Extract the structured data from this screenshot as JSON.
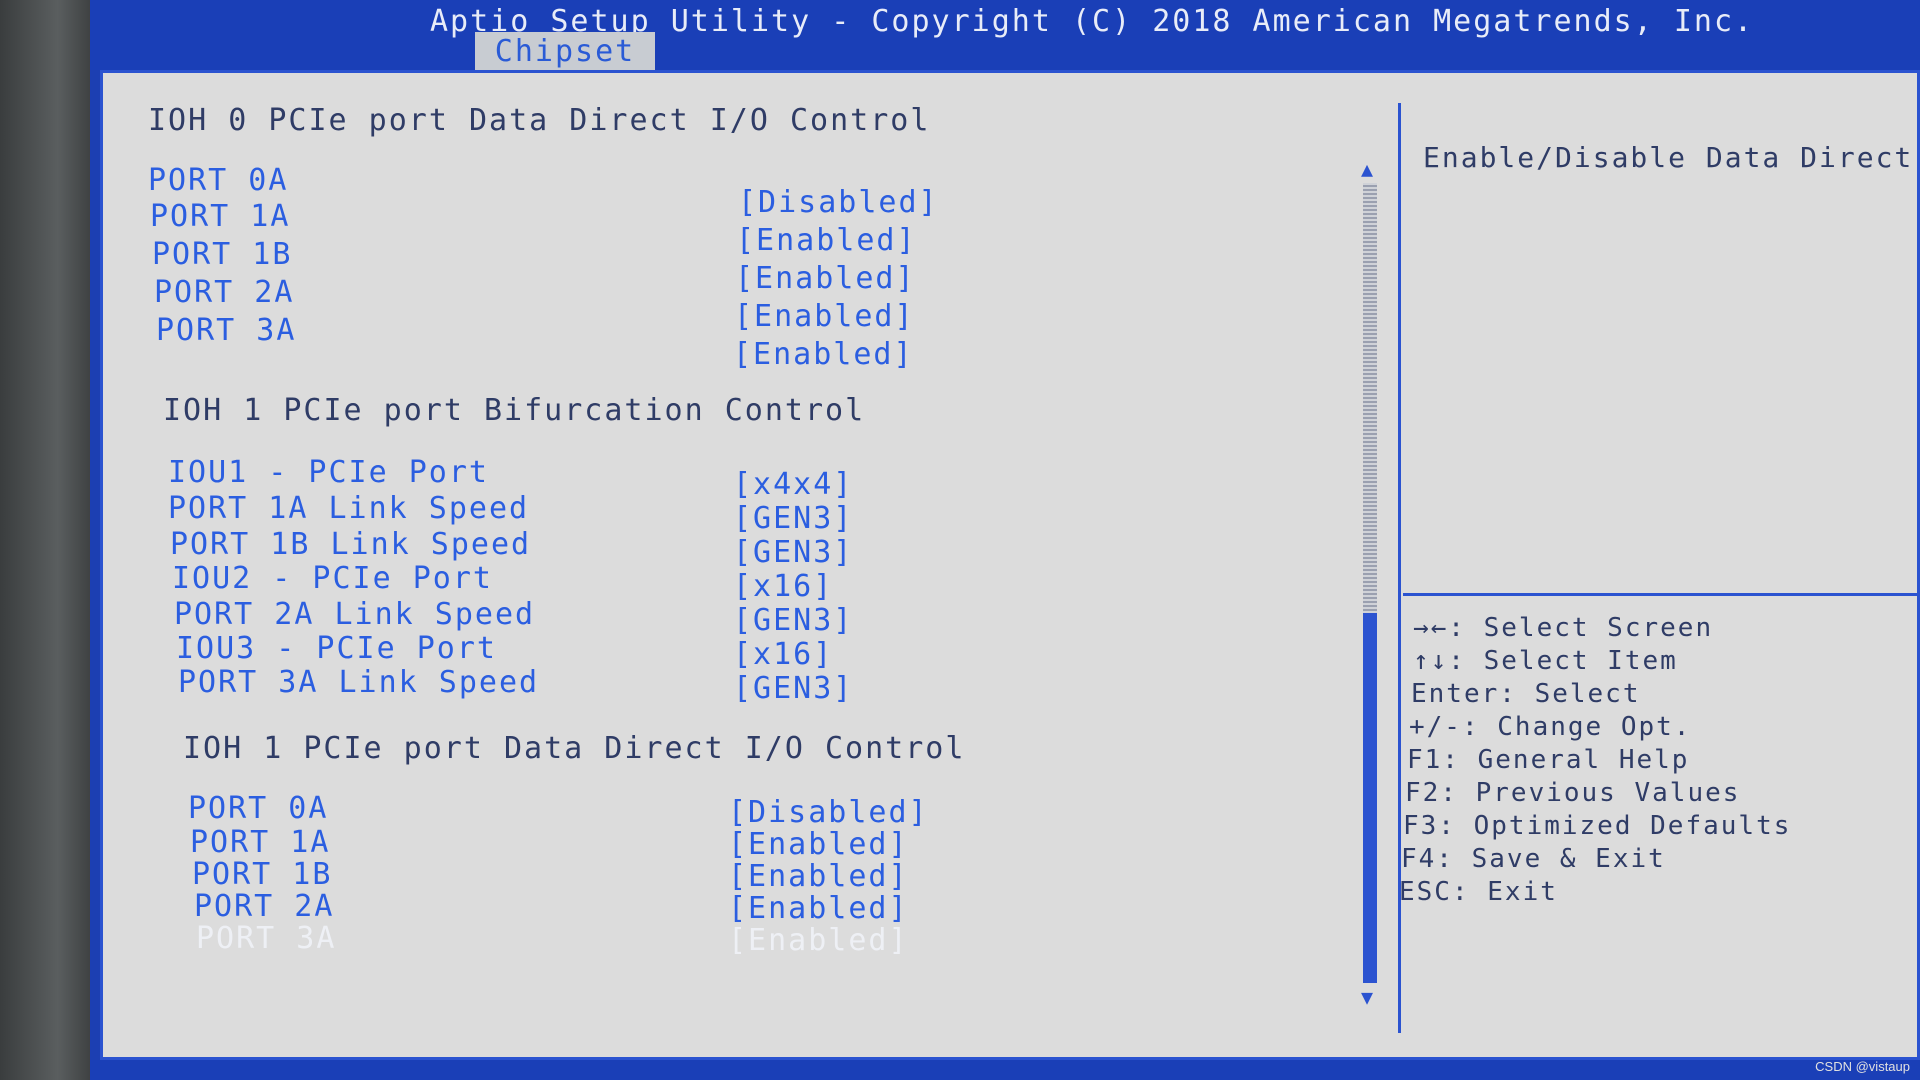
{
  "header": {
    "title": "Aptio Setup Utility - Copyright (C) 2018 American Megatrends, Inc.",
    "active_tab": "Chipset"
  },
  "sections": {
    "ioh0_ddio": {
      "heading": "IOH 0 PCIe port Data Direct I/O Control",
      "rows": [
        {
          "label": "PORT 0A",
          "value": "[Disabled]"
        },
        {
          "label": "PORT 1A",
          "value": "[Enabled]"
        },
        {
          "label": "PORT 1B",
          "value": "[Enabled]"
        },
        {
          "label": "PORT 2A",
          "value": "[Enabled]"
        },
        {
          "label": "PORT 3A",
          "value": "[Enabled]"
        }
      ]
    },
    "ioh1_bifurcation": {
      "heading": "IOH 1 PCIe port Bifurcation Control",
      "rows": [
        {
          "label": "IOU1 - PCIe Port",
          "value": "[x4x4]"
        },
        {
          "label": "PORT 1A Link Speed",
          "value": "[GEN3]"
        },
        {
          "label": "PORT 1B Link Speed",
          "value": "[GEN3]"
        },
        {
          "label": "IOU2 - PCIe Port",
          "value": "[x16]"
        },
        {
          "label": "PORT 2A Link Speed",
          "value": "[GEN3]"
        },
        {
          "label": "IOU3 - PCIe Port",
          "value": "[x16]"
        },
        {
          "label": "PORT 3A Link Speed",
          "value": "[GEN3]"
        }
      ]
    },
    "ioh1_ddio": {
      "heading": "IOH 1 PCIe port Data Direct I/O Control",
      "rows": [
        {
          "label": "PORT 0A",
          "value": "[Disabled]"
        },
        {
          "label": "PORT 1A",
          "value": "[Enabled]"
        },
        {
          "label": "PORT 1B",
          "value": "[Enabled]"
        },
        {
          "label": "PORT 2A",
          "value": "[Enabled]"
        },
        {
          "label": "PORT 3A",
          "value": "[Enabled]"
        }
      ]
    }
  },
  "help": {
    "description": "Enable/Disable Data Direct I/O",
    "keys": [
      "→←: Select Screen",
      "↑↓: Select Item",
      "Enter: Select",
      "+/-: Change Opt.",
      "F1: General Help",
      "F2: Previous Values",
      "F3: Optimized Defaults",
      "F4: Save & Exit",
      "ESC: Exit"
    ]
  },
  "watermark": "CSDN @vistaup",
  "colors": {
    "bios_blue": "#1a3fb7",
    "panel_gray": "#dcdcdc",
    "item_blue": "#2b5ee0",
    "heading_dark": "#2f3c66",
    "selected_white": "#eef0f5"
  }
}
